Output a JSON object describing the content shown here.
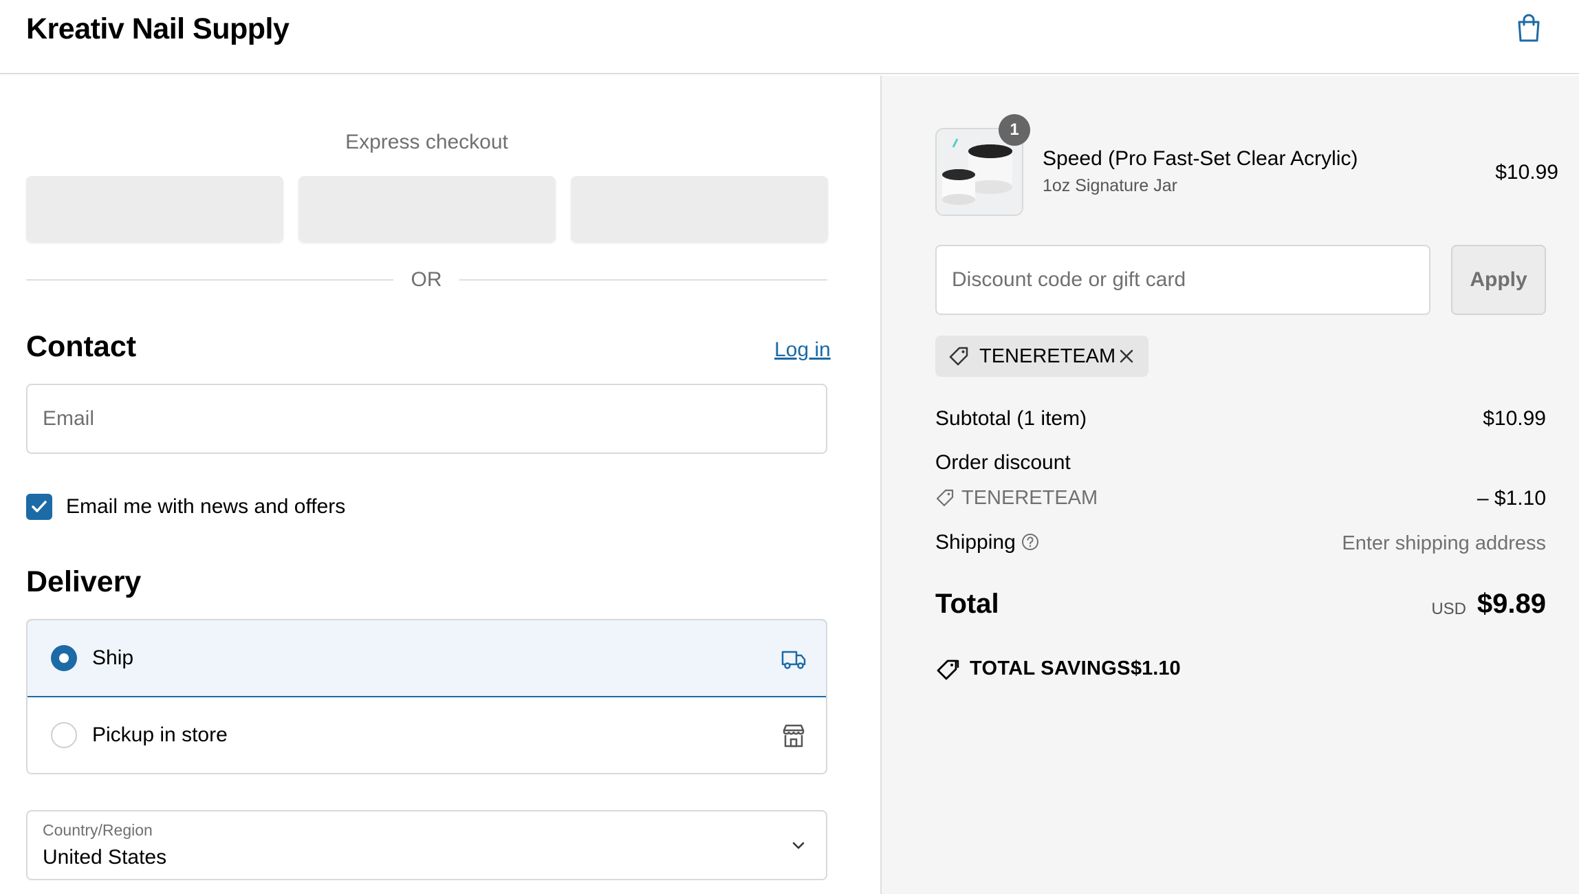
{
  "header": {
    "brand": "Kreativ Nail Supply"
  },
  "express": {
    "title": "Express checkout",
    "or_label": "OR"
  },
  "contact": {
    "title": "Contact",
    "login_label": "Log in",
    "email_placeholder": "Email",
    "newsletter_label": "Email me with news and offers",
    "newsletter_checked": true
  },
  "delivery": {
    "title": "Delivery",
    "options": [
      {
        "label": "Ship",
        "selected": true,
        "icon": "truck-icon"
      },
      {
        "label": "Pickup in store",
        "selected": false,
        "icon": "store-icon"
      }
    ],
    "country_label": "Country/Region",
    "country_value": "United States"
  },
  "summary": {
    "product": {
      "quantity": "1",
      "name": "Speed (Pro Fast-Set Clear Acrylic)",
      "variant": "1oz Signature Jar",
      "price": "$10.99"
    },
    "discount_placeholder": "Discount code or gift card",
    "apply_label": "Apply",
    "applied_code": "TENERETEAM",
    "subtotal_label": "Subtotal (1 item)",
    "subtotal_value": "$10.99",
    "order_discount_label": "Order discount",
    "order_discount_code": "TENERETEAM",
    "order_discount_value": "– $1.10",
    "shipping_label": "Shipping",
    "shipping_value": "Enter shipping address",
    "total_label": "Total",
    "currency": "USD",
    "total_value": "$9.89",
    "savings_label": "TOTAL SAVINGS",
    "savings_value": "$1.10"
  },
  "watermark": "Tenereteam",
  "colors": {
    "accent": "#1c6aa6",
    "muted_text": "#707070",
    "summary_bg": "#f5f5f5"
  }
}
